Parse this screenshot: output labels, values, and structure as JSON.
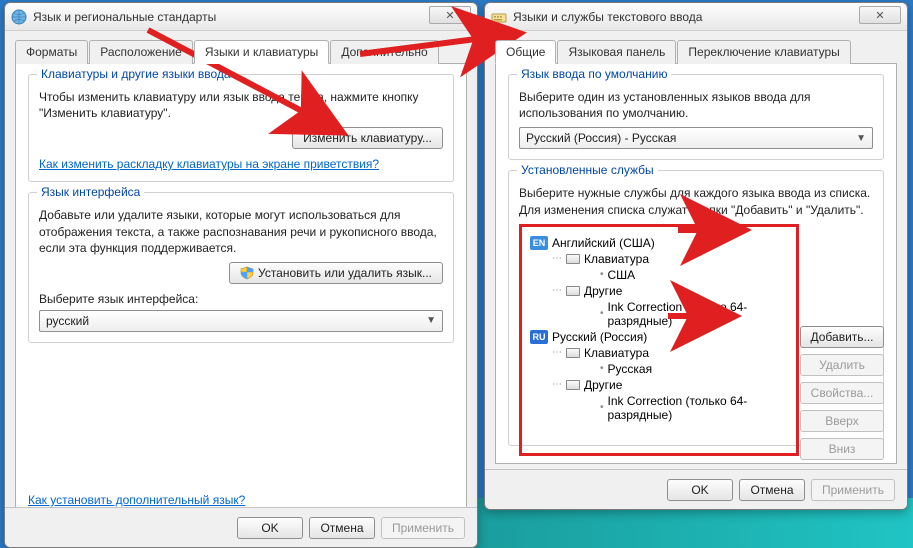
{
  "left_window": {
    "title": "Язык и региональные стандарты",
    "tabs": [
      "Форматы",
      "Расположение",
      "Языки и клавиатуры",
      "Дополнительно"
    ],
    "group_keyboards": {
      "legend": "Клавиатуры и другие языки ввода",
      "text": "Чтобы изменить клавиатуру или язык ввода текста, нажмите кнопку \"Изменить клавиатуру\".",
      "button": "Изменить клавиатуру...",
      "link": "Как изменить раскладку клавиатуры на экране приветствия?"
    },
    "group_ui": {
      "legend": "Язык интерфейса",
      "text": "Добавьте или удалите языки, которые могут использоваться для отображения текста, а также распознавания речи и рукописного ввода, если эта функция поддерживается.",
      "button": "Установить или удалить язык...",
      "select_label": "Выберите язык интерфейса:",
      "select_value": "русский"
    },
    "bottom_link": "Как установить дополнительный язык?",
    "buttons": {
      "ok": "OK",
      "cancel": "Отмена",
      "apply": "Применить"
    }
  },
  "right_window": {
    "title": "Языки и службы текстового ввода",
    "tabs": [
      "Общие",
      "Языковая панель",
      "Переключение клавиатуры"
    ],
    "group_default": {
      "legend": "Язык ввода по умолчанию",
      "text": "Выберите один из установленных языков ввода для использования по умолчанию.",
      "dropdown_value": "Русский (Россия) - Русская"
    },
    "group_services": {
      "legend": "Установленные службы",
      "text": "Выберите нужные службы для каждого языка ввода из списка. Для изменения списка служат кнопки \"Добавить\" и \"Удалить\".",
      "tree": {
        "en": {
          "badge": "EN",
          "label": "Английский (США)",
          "kb_header": "Клавиатура",
          "kb_item": "США",
          "other_header": "Другие",
          "other_item": "Ink Correction (только 64-разрядные)"
        },
        "ru": {
          "badge": "RU",
          "label": "Русский (Россия)",
          "kb_header": "Клавиатура",
          "kb_item": "Русская",
          "other_header": "Другие",
          "other_item": "Ink Correction (только 64-разрядные)"
        }
      },
      "side_buttons": {
        "add": "Добавить...",
        "remove": "Удалить",
        "props": "Свойства...",
        "up": "Вверх",
        "down": "Вниз"
      }
    },
    "buttons": {
      "ok": "OK",
      "cancel": "Отмена",
      "apply": "Применить"
    }
  }
}
